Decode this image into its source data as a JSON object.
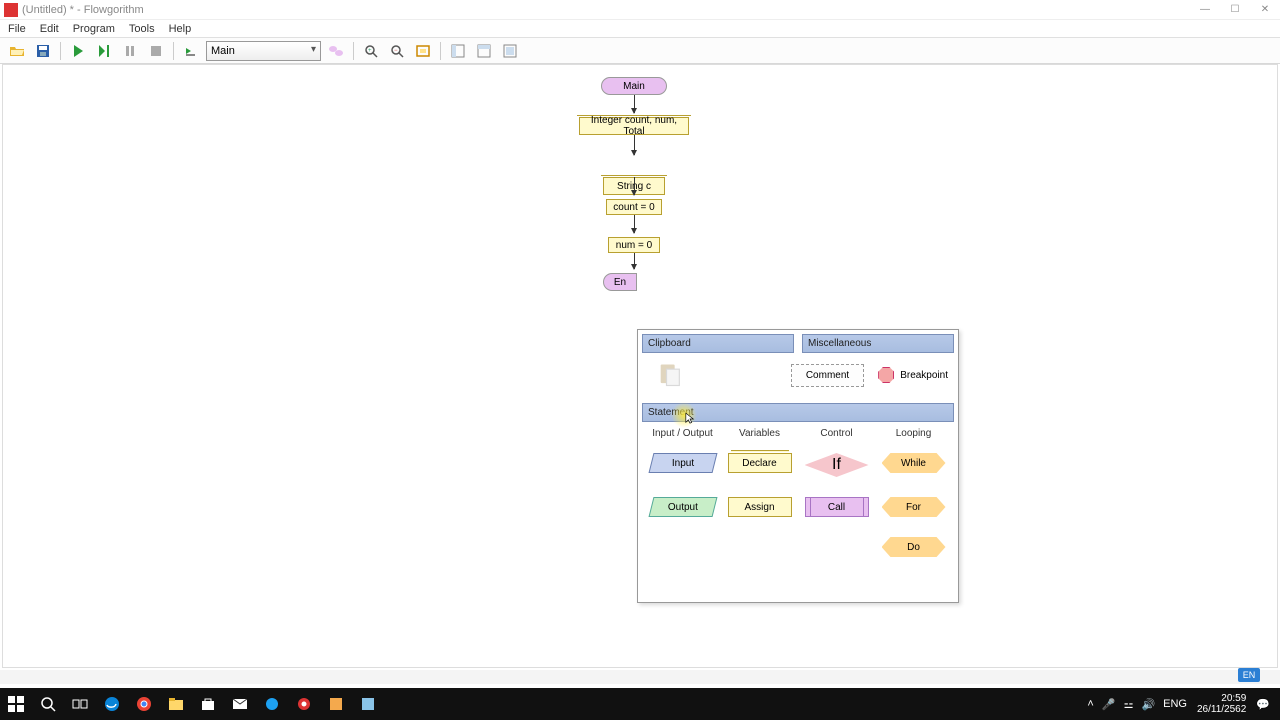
{
  "title": "(Untitled) * - Flowgorithm",
  "menu": {
    "file": "File",
    "edit": "Edit",
    "program": "Program",
    "tools": "Tools",
    "help": "Help"
  },
  "toolbar": {
    "function": "Main"
  },
  "flowchart": {
    "start": "Main",
    "declare1": "Integer count, num, Total",
    "declare2": "String c",
    "assign1": "count = 0",
    "assign2": "num = 0",
    "end": "En"
  },
  "popup": {
    "clipboard": "Clipboard",
    "misc": "Miscellaneous",
    "comment": "Comment",
    "breakpoint": "Breakpoint",
    "statement": "Statement",
    "cat_io": "Input / Output",
    "cat_var": "Variables",
    "cat_ctrl": "Control",
    "cat_loop": "Looping",
    "input": "Input",
    "declare": "Declare",
    "if": "If",
    "while": "While",
    "output": "Output",
    "assign": "Assign",
    "call": "Call",
    "for": "For",
    "do": "Do"
  },
  "en_badge": "EN",
  "tray": {
    "keyboard": "ENG",
    "time": "20:59",
    "date": "26/11/2562"
  }
}
